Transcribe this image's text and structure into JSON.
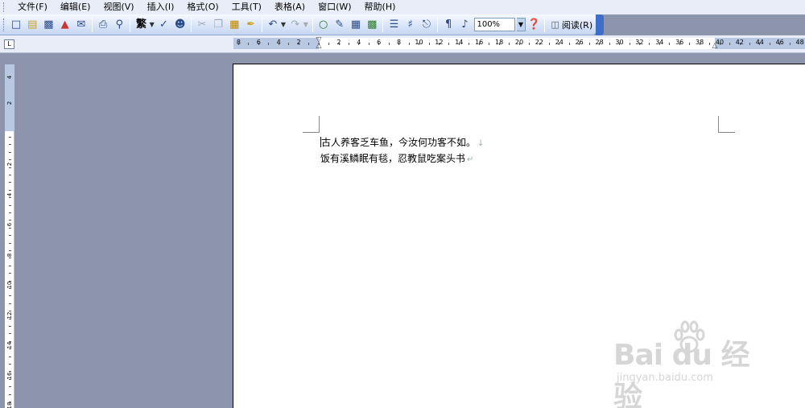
{
  "menu": {
    "items": [
      "文件(F)",
      "编辑(E)",
      "视图(V)",
      "插入(I)",
      "格式(O)",
      "工具(T)",
      "表格(A)",
      "窗口(W)",
      "帮助(H)"
    ]
  },
  "toolbar": {
    "fanti_label": "繁",
    "zoom_value": "100%",
    "read_label": "阅读(R)"
  },
  "ruler": {
    "tab_selector": "L",
    "h_left_numbers": [
      "8",
      "6",
      "4",
      "2"
    ],
    "h_right_numbers": [
      "2",
      "4",
      "6",
      "8",
      "10",
      "12",
      "14",
      "16",
      "18",
      "20",
      "22",
      "24",
      "26",
      "28",
      "30",
      "32",
      "34",
      "36",
      "38",
      "40",
      "42",
      "44",
      "46",
      "48"
    ],
    "v_top_numbers": [
      "4",
      "2"
    ],
    "v_numbers": [
      "2",
      "4",
      "6",
      "8",
      "10",
      "12",
      "14",
      "16",
      "18"
    ]
  },
  "document": {
    "lines": [
      "古人养客乏车鱼，今汝何功客不如。",
      "饭有溪鳞眠有毯，忍教鼠吃案头书"
    ],
    "line_break_mark": "↓",
    "paragraph_mark": "↵"
  },
  "watermark": {
    "brand": "Bai du",
    "brand_cn": "经验",
    "url": "jingyan.baidu.com"
  }
}
